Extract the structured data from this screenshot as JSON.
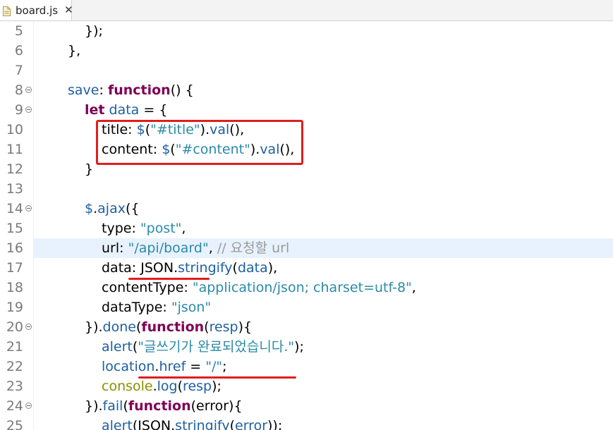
{
  "tab": {
    "file_name": "board.js",
    "close_glyph": "✕",
    "icon": "js-file-icon"
  },
  "annotations": {
    "color": "#e01e1e"
  },
  "editor": {
    "lines": [
      {
        "num": "5",
        "indent": 1,
        "fold": false,
        "current": false,
        "tokens": [
          {
            "t": "plain",
            "v": "});"
          }
        ]
      },
      {
        "num": "6",
        "indent": 0,
        "fold": false,
        "current": false,
        "tokens": [
          {
            "t": "plain",
            "v": "},"
          }
        ]
      },
      {
        "num": "7",
        "indent": 0,
        "fold": false,
        "current": false,
        "tokens": []
      },
      {
        "num": "8",
        "indent": 0,
        "fold": true,
        "current": false,
        "tokens": [
          {
            "t": "var",
            "v": "save"
          },
          {
            "t": "plain",
            "v": ": "
          },
          {
            "t": "kw",
            "v": "function"
          },
          {
            "t": "plain",
            "v": "() {"
          }
        ]
      },
      {
        "num": "9",
        "indent": 1,
        "fold": true,
        "current": false,
        "tokens": [
          {
            "t": "kw",
            "v": "let"
          },
          {
            "t": "plain",
            "v": " "
          },
          {
            "t": "var",
            "v": "data"
          },
          {
            "t": "plain",
            "v": " = {"
          }
        ]
      },
      {
        "num": "10",
        "indent": 2,
        "fold": false,
        "current": false,
        "tokens": [
          {
            "t": "plain",
            "v": "title: "
          },
          {
            "t": "var",
            "v": "$"
          },
          {
            "t": "plain",
            "v": "("
          },
          {
            "t": "str",
            "v": "\"#title\""
          },
          {
            "t": "plain",
            "v": ")."
          },
          {
            "t": "var",
            "v": "val"
          },
          {
            "t": "plain",
            "v": "(),"
          }
        ]
      },
      {
        "num": "11",
        "indent": 2,
        "fold": false,
        "current": false,
        "tokens": [
          {
            "t": "plain",
            "v": "content: "
          },
          {
            "t": "var",
            "v": "$"
          },
          {
            "t": "plain",
            "v": "("
          },
          {
            "t": "str",
            "v": "\"#content\""
          },
          {
            "t": "plain",
            "v": ")."
          },
          {
            "t": "var",
            "v": "val"
          },
          {
            "t": "plain",
            "v": "(),"
          }
        ]
      },
      {
        "num": "12",
        "indent": 1,
        "fold": false,
        "current": false,
        "tokens": [
          {
            "t": "plain",
            "v": "}"
          }
        ]
      },
      {
        "num": "13",
        "indent": 0,
        "fold": false,
        "current": false,
        "tokens": []
      },
      {
        "num": "14",
        "indent": 1,
        "fold": true,
        "current": false,
        "tokens": [
          {
            "t": "var",
            "v": "$"
          },
          {
            "t": "plain",
            "v": "."
          },
          {
            "t": "var",
            "v": "ajax"
          },
          {
            "t": "plain",
            "v": "({"
          }
        ]
      },
      {
        "num": "15",
        "indent": 2,
        "fold": false,
        "current": false,
        "tokens": [
          {
            "t": "plain",
            "v": "type: "
          },
          {
            "t": "str",
            "v": "\"post\""
          },
          {
            "t": "plain",
            "v": ","
          }
        ]
      },
      {
        "num": "16",
        "indent": 2,
        "fold": false,
        "current": true,
        "tokens": [
          {
            "t": "plain",
            "v": "url: "
          },
          {
            "t": "str",
            "v": "\"/api/board\""
          },
          {
            "t": "plain",
            "v": ", "
          },
          {
            "t": "cmt",
            "v": "// 요청할 url"
          }
        ]
      },
      {
        "num": "17",
        "indent": 2,
        "fold": false,
        "current": false,
        "tokens": [
          {
            "t": "plain",
            "v": "data: JSON."
          },
          {
            "t": "var",
            "v": "stringify"
          },
          {
            "t": "plain",
            "v": "("
          },
          {
            "t": "var",
            "v": "data"
          },
          {
            "t": "plain",
            "v": "),"
          }
        ]
      },
      {
        "num": "18",
        "indent": 2,
        "fold": false,
        "current": false,
        "tokens": [
          {
            "t": "plain",
            "v": "contentType: "
          },
          {
            "t": "str",
            "v": "\"application/json; charset=utf-8\""
          },
          {
            "t": "plain",
            "v": ","
          }
        ]
      },
      {
        "num": "19",
        "indent": 2,
        "fold": false,
        "current": false,
        "tokens": [
          {
            "t": "plain",
            "v": "dataType: "
          },
          {
            "t": "str",
            "v": "\"json\""
          }
        ]
      },
      {
        "num": "20",
        "indent": 1,
        "fold": true,
        "current": false,
        "tokens": [
          {
            "t": "plain",
            "v": "})."
          },
          {
            "t": "var",
            "v": "done"
          },
          {
            "t": "plain",
            "v": "("
          },
          {
            "t": "kw",
            "v": "function"
          },
          {
            "t": "plain",
            "v": "("
          },
          {
            "t": "var",
            "v": "resp"
          },
          {
            "t": "plain",
            "v": "){"
          }
        ]
      },
      {
        "num": "21",
        "indent": 2,
        "fold": false,
        "current": false,
        "tokens": [
          {
            "t": "var",
            "v": "alert"
          },
          {
            "t": "plain",
            "v": "("
          },
          {
            "t": "str",
            "v": "\"글쓰기가 완료되었습니다.\""
          },
          {
            "t": "plain",
            "v": ");"
          }
        ]
      },
      {
        "num": "22",
        "indent": 2,
        "fold": false,
        "current": false,
        "tokens": [
          {
            "t": "var",
            "v": "location"
          },
          {
            "t": "plain",
            "v": "."
          },
          {
            "t": "var",
            "v": "href"
          },
          {
            "t": "plain",
            "v": " = "
          },
          {
            "t": "str",
            "v": "\"/\""
          },
          {
            "t": "plain",
            "v": ";"
          }
        ]
      },
      {
        "num": "23",
        "indent": 2,
        "fold": false,
        "current": false,
        "tokens": [
          {
            "t": "obj",
            "v": "console"
          },
          {
            "t": "plain",
            "v": "."
          },
          {
            "t": "var",
            "v": "log"
          },
          {
            "t": "plain",
            "v": "("
          },
          {
            "t": "var",
            "v": "resp"
          },
          {
            "t": "plain",
            "v": ");"
          }
        ]
      },
      {
        "num": "24",
        "indent": 1,
        "fold": true,
        "current": false,
        "tokens": [
          {
            "t": "plain",
            "v": "})."
          },
          {
            "t": "var",
            "v": "fail"
          },
          {
            "t": "plain",
            "v": "("
          },
          {
            "t": "kw",
            "v": "function"
          },
          {
            "t": "plain",
            "v": "(error){"
          }
        ]
      },
      {
        "num": "25",
        "indent": 2,
        "fold": false,
        "current": false,
        "tokens": [
          {
            "t": "var",
            "v": "alert"
          },
          {
            "t": "plain",
            "v": "(JSON."
          },
          {
            "t": "var",
            "v": "stringify"
          },
          {
            "t": "plain",
            "v": "("
          },
          {
            "t": "var",
            "v": "error"
          },
          {
            "t": "plain",
            "v": "));"
          }
        ]
      }
    ]
  }
}
